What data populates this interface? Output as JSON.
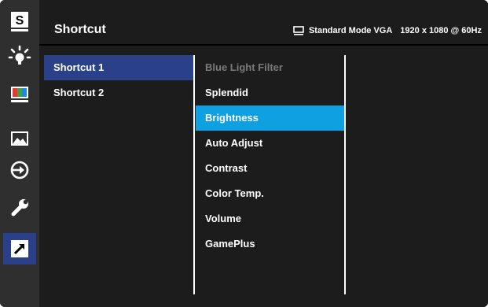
{
  "header": {
    "title": "Shortcut",
    "status_mode": "Standard Mode VGA",
    "status_resolution": "1920 x 1080 @ 60Hz",
    "monitor_icon": "monitor-icon"
  },
  "sidebar": {
    "items": [
      {
        "icon": "splendid-s-icon",
        "label": "S"
      },
      {
        "icon": "blue-light-icon"
      },
      {
        "icon": "color-bars-icon"
      },
      {
        "icon": "image-icon"
      },
      {
        "icon": "input-select-icon"
      },
      {
        "icon": "system-setup-wrench-icon"
      },
      {
        "icon": "shortcut-arrow-icon",
        "active": true
      }
    ]
  },
  "shortcut_list": [
    {
      "label": "Shortcut 1",
      "selected": true
    },
    {
      "label": "Shortcut 2",
      "selected": false
    }
  ],
  "function_list": [
    {
      "label": "Blue Light Filter",
      "state": "disabled"
    },
    {
      "label": "Splendid",
      "state": "normal"
    },
    {
      "label": "Brightness",
      "state": "highlighted"
    },
    {
      "label": "Auto Adjust",
      "state": "normal"
    },
    {
      "label": "Contrast",
      "state": "normal"
    },
    {
      "label": "Color Temp.",
      "state": "normal"
    },
    {
      "label": "Volume",
      "state": "normal"
    },
    {
      "label": "GamePlus",
      "state": "normal"
    }
  ],
  "colors": {
    "selection_blue": "#2a418a",
    "highlight_cyan": "#0ea0e0",
    "disabled_text": "#7a7a7a",
    "background": "#1c1c1c",
    "sidebar": "#2f2f2f"
  }
}
